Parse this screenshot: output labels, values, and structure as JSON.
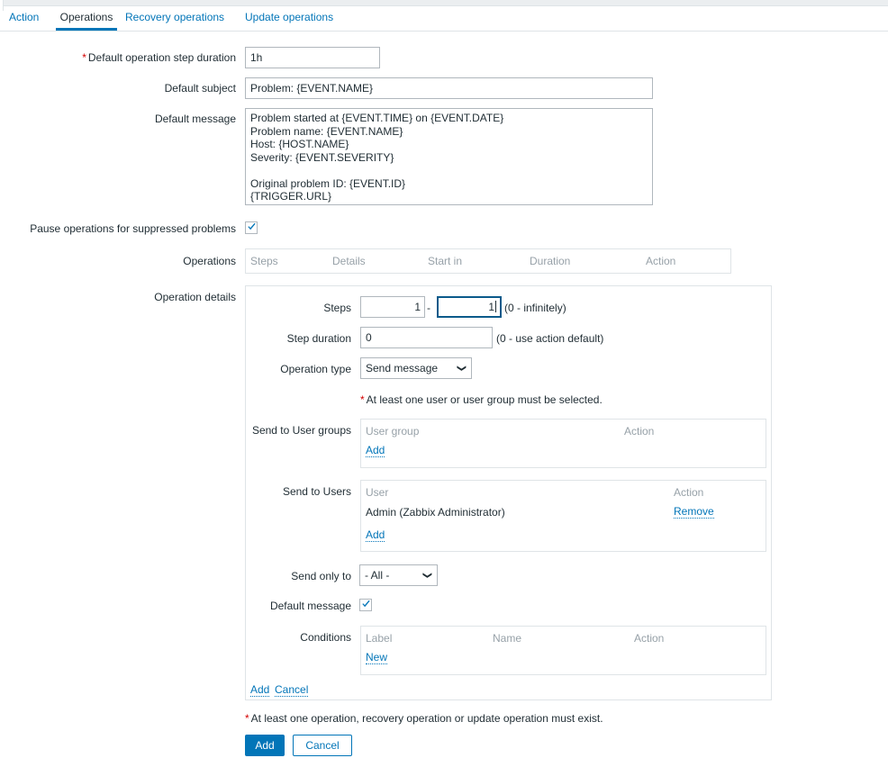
{
  "tabs": [
    {
      "label": "Action",
      "active": false
    },
    {
      "label": "Operations",
      "active": true
    },
    {
      "label": "Recovery operations",
      "active": false
    },
    {
      "label": "Update operations",
      "active": false
    }
  ],
  "form": {
    "step_duration_label": "Default operation step duration",
    "step_duration_value": "1h",
    "subject_label": "Default subject",
    "subject_value": "Problem: {EVENT.NAME}",
    "message_label": "Default message",
    "message_value": "Problem started at {EVENT.TIME} on {EVENT.DATE}\nProblem name: {EVENT.NAME}\nHost: {HOST.NAME}\nSeverity: {EVENT.SEVERITY}\n\nOriginal problem ID: {EVENT.ID}\n{TRIGGER.URL}",
    "pause_label": "Pause operations for suppressed problems",
    "pause_checked": "checked",
    "operations_label": "Operations"
  },
  "operations_table": {
    "columns": [
      "Steps",
      "Details",
      "Start in",
      "Duration",
      "Action"
    ]
  },
  "operation_details": {
    "label": "Operation details",
    "steps_label": "Steps",
    "steps_from": "1",
    "steps_to": "1",
    "steps_separator": "-",
    "steps_hint": "(0 - infinitely)",
    "step_duration_label": "Step duration",
    "step_duration_value": "0",
    "step_duration_hint": "(0 - use action default)",
    "operation_type_label": "Operation type",
    "operation_type_value": "Send message",
    "operation_type_options": [
      "Send message"
    ],
    "user_required_note": "At least one user or user group must be selected.",
    "user_groups_label": "Send to User groups",
    "user_groups_columns": [
      "User group",
      "Action"
    ],
    "user_groups_add": "Add",
    "users_label": "Send to Users",
    "users_columns": [
      "User",
      "Action"
    ],
    "users_rows": [
      {
        "user": "Admin (Zabbix Administrator)",
        "action": "Remove"
      }
    ],
    "users_add": "Add",
    "send_only_to_label": "Send only to",
    "send_only_to_value": "- All -",
    "send_only_to_options": [
      "- All -"
    ],
    "default_message_label": "Default message",
    "default_message_checked": "checked",
    "conditions_label": "Conditions",
    "conditions_columns": [
      "Label",
      "Name",
      "Action"
    ],
    "conditions_new": "New",
    "panel_add": "Add",
    "panel_cancel": "Cancel"
  },
  "footer": {
    "required_note": "At least one operation, recovery operation or update operation must exist.",
    "add_label": "Add",
    "cancel_label": "Cancel"
  },
  "colors": {
    "accent": "#0275b8",
    "required": "#d40000",
    "text": "#1f2c33",
    "muted": "#97a1a8",
    "border": "#dfe4e7"
  }
}
